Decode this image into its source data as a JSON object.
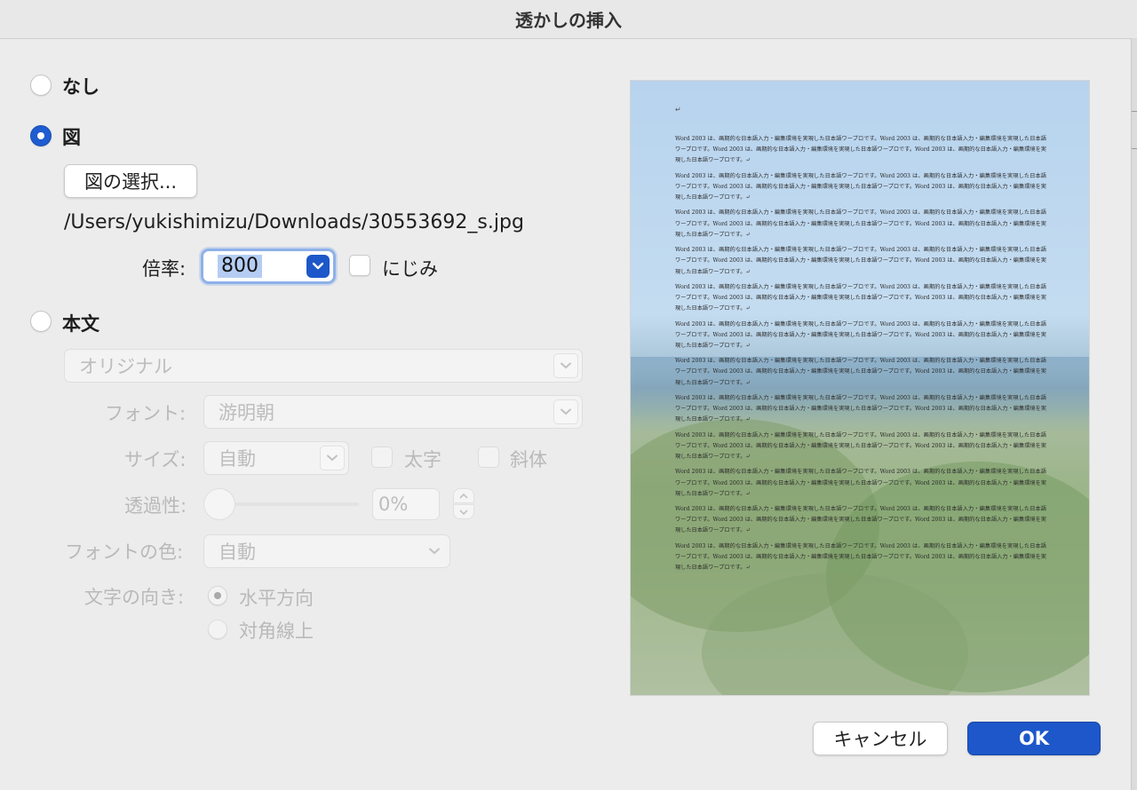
{
  "window": {
    "title": "透かしの挿入"
  },
  "options": {
    "none_label": "なし",
    "picture_label": "図",
    "text_label": "本文"
  },
  "picture": {
    "select_button": "図の選択...",
    "file_path": "/Users/yukishimizu/Downloads/30553692_s.jpg",
    "scale_label": "倍率:",
    "scale_value": "800",
    "washout_label": "にじみ"
  },
  "text_watermark": {
    "preset_value": "オリジナル",
    "font_label": "フォント:",
    "font_value": "游明朝",
    "size_label": "サイズ:",
    "size_value": "自動",
    "bold_label": "太字",
    "italic_label": "斜体",
    "transparency_label": "透過性:",
    "transparency_value": "0%",
    "color_label": "フォントの色:",
    "color_value": "自動",
    "direction_label": "文字の向き:",
    "horizontal_label": "水平方向",
    "diagonal_label": "対角線上"
  },
  "preview": {
    "paragraph_mark": "↵",
    "paragraphs": [
      "Word 2003 は、画期的な日本語入力・編集環境を実現した日本語ワープロです。Word 2003 は、画期的な日本語入力・編集環境を実現した日本語ワープロです。Word 2003 は、画期的な日本語入力・編集環境を実現した日本語ワープロです。Word 2003 は、画期的な日本語入力・編集環境を実現した日本語ワープロです。↵",
      "Word 2003 は、画期的な日本語入力・編集環境を実現した日本語ワープロです。Word 2003 は、画期的な日本語入力・編集環境を実現した日本語ワープロです。Word 2003 は、画期的な日本語入力・編集環境を実現した日本語ワープロです。Word 2003 は、画期的な日本語入力・編集環境を実現した日本語ワープロです。↵",
      "Word 2003 は、画期的な日本語入力・編集環境を実現した日本語ワープロです。Word 2003 は、画期的な日本語入力・編集環境を実現した日本語ワープロです。Word 2003 は、画期的な日本語入力・編集環境を実現した日本語ワープロです。Word 2003 は、画期的な日本語入力・編集環境を実現した日本語ワープロです。↵",
      "Word 2003 は、画期的な日本語入力・編集環境を実現した日本語ワープロです。Word 2003 は、画期的な日本語入力・編集環境を実現した日本語ワープロです。Word 2003 は、画期的な日本語入力・編集環境を実現した日本語ワープロです。Word 2003 は、画期的な日本語入力・編集環境を実現した日本語ワープロです。↵",
      "Word 2003 は、画期的な日本語入力・編集環境を実現した日本語ワープロです。Word 2003 は、画期的な日本語入力・編集環境を実現した日本語ワープロです。Word 2003 は、画期的な日本語入力・編集環境を実現した日本語ワープロです。Word 2003 は、画期的な日本語入力・編集環境を実現した日本語ワープロです。↵",
      "Word 2003 は、画期的な日本語入力・編集環境を実現した日本語ワープロです。Word 2003 は、画期的な日本語入力・編集環境を実現した日本語ワープロです。Word 2003 は、画期的な日本語入力・編集環境を実現した日本語ワープロです。Word 2003 は、画期的な日本語入力・編集環境を実現した日本語ワープロです。↵",
      "Word 2003 は、画期的な日本語入力・編集環境を実現した日本語ワープロです。Word 2003 は、画期的な日本語入力・編集環境を実現した日本語ワープロです。Word 2003 は、画期的な日本語入力・編集環境を実現した日本語ワープロです。Word 2003 は、画期的な日本語入力・編集環境を実現した日本語ワープロです。↵",
      "Word 2003 は、画期的な日本語入力・編集環境を実現した日本語ワープロです。Word 2003 は、画期的な日本語入力・編集環境を実現した日本語ワープロです。Word 2003 は、画期的な日本語入力・編集環境を実現した日本語ワープロです。Word 2003 は、画期的な日本語入力・編集環境を実現した日本語ワープロです。↵",
      "Word 2003 は、画期的な日本語入力・編集環境を実現した日本語ワープロです。Word 2003 は、画期的な日本語入力・編集環境を実現した日本語ワープロです。Word 2003 は、画期的な日本語入力・編集環境を実現した日本語ワープロです。Word 2003 は、画期的な日本語入力・編集環境を実現した日本語ワープロです。↵",
      "Word 2003 は、画期的な日本語入力・編集環境を実現した日本語ワープロです。Word 2003 は、画期的な日本語入力・編集環境を実現した日本語ワープロです。Word 2003 は、画期的な日本語入力・編集環境を実現した日本語ワープロです。Word 2003 は、画期的な日本語入力・編集環境を実現した日本語ワープロです。↵",
      "Word 2003 は、画期的な日本語入力・編集環境を実現した日本語ワープロです。Word 2003 は、画期的な日本語入力・編集環境を実現した日本語ワープロです。Word 2003 は、画期的な日本語入力・編集環境を実現した日本語ワープロです。Word 2003 は、画期的な日本語入力・編集環境を実現した日本語ワープロです。↵",
      "Word 2003 は、画期的な日本語入力・編集環境を実現した日本語ワープロです。Word 2003 は、画期的な日本語入力・編集環境を実現した日本語ワープロです。Word 2003 は、画期的な日本語入力・編集環境を実現した日本語ワープロです。Word 2003 は、画期的な日本語入力・編集環境を実現した日本語ワープロです。↵"
    ]
  },
  "buttons": {
    "cancel": "キャンセル",
    "ok": "OK"
  },
  "colors": {
    "accent": "#1d57c9",
    "dialog_bg": "#ececec",
    "disabled_text": "#b9b9b9"
  },
  "icons": {
    "radio_selected": "radio-selected-icon",
    "chevron_down": "chevron-down-icon",
    "stepper": "stepper-icon"
  }
}
